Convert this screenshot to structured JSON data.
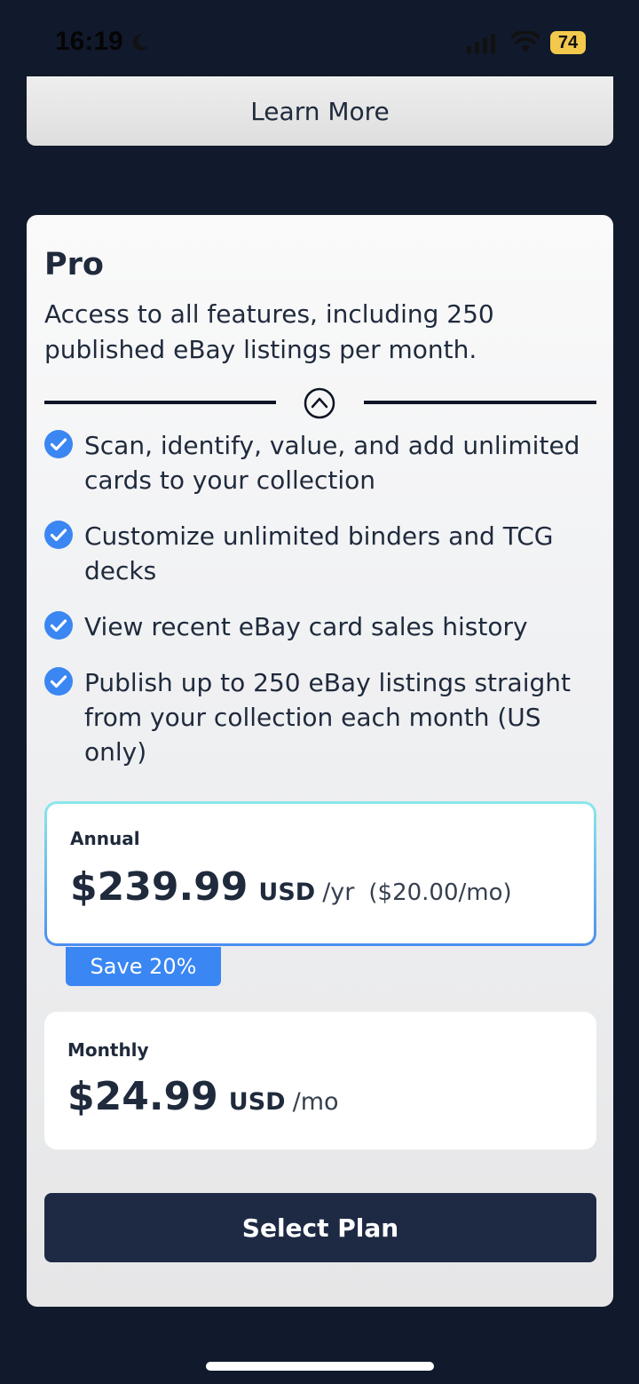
{
  "status_bar": {
    "time": "16:19",
    "battery": "74",
    "icons": [
      "moon-icon",
      "cellular-signal-icon",
      "wifi-icon",
      "battery-charging-icon"
    ]
  },
  "learn_more": {
    "label": "Learn More"
  },
  "plan": {
    "title": "Pro",
    "description": "Access to all features, including 250 published eBay listings per month.",
    "features": [
      "Scan, identify, value, and add unlimited cards to your collection",
      "Customize unlimited binders and TCG decks",
      "View recent eBay card sales history",
      "Publish up to 250 eBay listings straight from your collection each month (US only)"
    ],
    "options": {
      "annual": {
        "label": "Annual",
        "price": "$239.99",
        "currency": "USD",
        "period": "/yr",
        "per_month": "($20.00/mo)",
        "badge": "Save 20%"
      },
      "monthly": {
        "label": "Monthly",
        "price": "$24.99",
        "currency": "USD",
        "period": "/mo"
      }
    },
    "select_button": "Select Plan"
  },
  "colors": {
    "background": "#111a2c",
    "accent": "#3a86f2",
    "primary_button": "#1e2a44",
    "text": "#1f2a3c"
  }
}
